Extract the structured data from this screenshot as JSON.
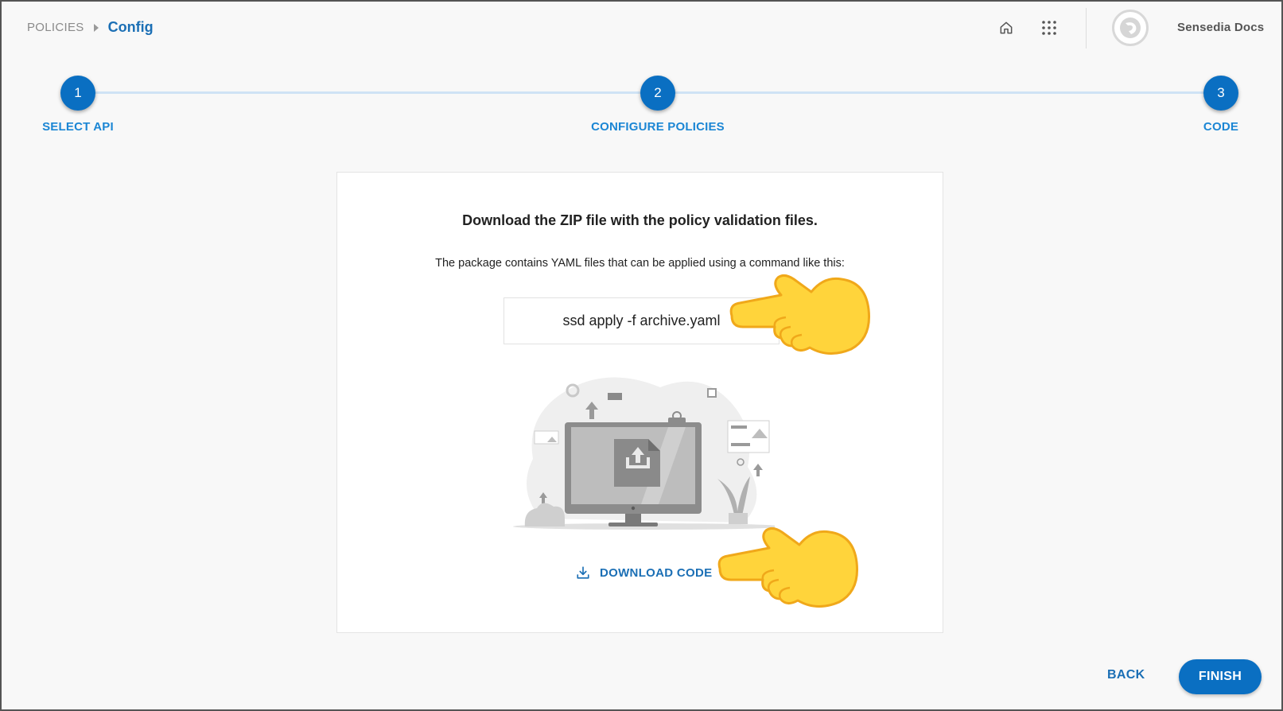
{
  "breadcrumb": {
    "root": "POLICIES",
    "current": "Config"
  },
  "header": {
    "user_name": "Sensedia Docs"
  },
  "stepper": {
    "steps": [
      {
        "number": "1",
        "label": "SELECT API"
      },
      {
        "number": "2",
        "label": "CONFIGURE POLICIES"
      },
      {
        "number": "3",
        "label": "CODE"
      }
    ],
    "active_step": 3
  },
  "card": {
    "title": "Download the ZIP file with the policy validation files.",
    "subtitle": "The package contains YAML files that can be applied using a command like this:",
    "command": "ssd apply -f archive.yaml",
    "download_label": "DOWNLOAD CODE"
  },
  "footer": {
    "back_label": "BACK",
    "finish_label": "FINISH"
  },
  "colors": {
    "primary": "#0a6fc2",
    "link": "#1b6fb5",
    "step_label": "#1b86d4",
    "hand": "#ffd43b"
  },
  "icons": [
    "home-icon",
    "apps-grid-icon",
    "avatar-logo-icon",
    "download-icon",
    "pointing-hand-icon"
  ]
}
